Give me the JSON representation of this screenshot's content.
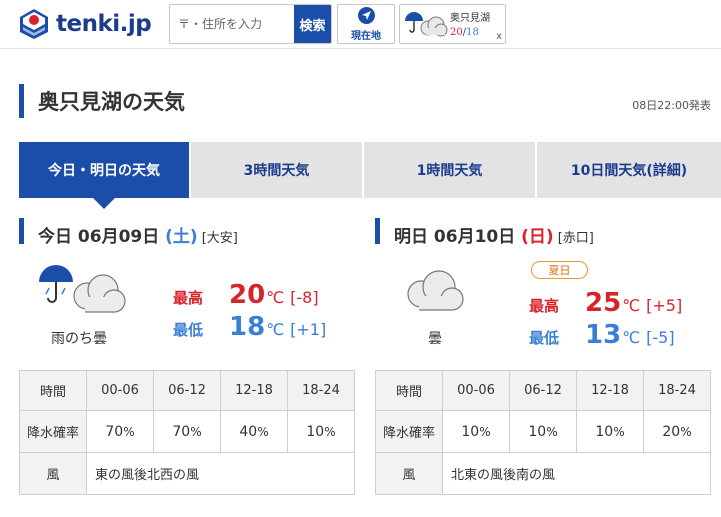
{
  "header": {
    "logo_text": "tenki.jp",
    "search_placeholder": "〒・住所を入力",
    "search_button": "検索",
    "location_button": "現在地",
    "mini_card": {
      "place": "奥只見湖",
      "high": "20",
      "separator": "/",
      "low": "18",
      "close": "x"
    }
  },
  "page": {
    "title": "奥只見湖の天気",
    "announced": "08日22:00発表"
  },
  "tabs": [
    {
      "label": "今日・明日の天気",
      "active": true
    },
    {
      "label": "3時間天気",
      "active": false
    },
    {
      "label": "1時間天気",
      "active": false
    },
    {
      "label": "10日間天気(詳細)",
      "active": false
    }
  ],
  "today": {
    "prefix": "今日 06月09日 ",
    "weekday": "(土)",
    "rokuyo": "[大安]",
    "telop": "雨のち曇",
    "high_label": "最高",
    "high": "20",
    "high_unit": "℃",
    "high_diff": "[-8]",
    "low_label": "最低",
    "low": "18",
    "low_unit": "℃",
    "low_diff": "[+1]",
    "table": {
      "time_label": "時間",
      "slots": [
        "00-06",
        "06-12",
        "12-18",
        "18-24"
      ],
      "precip_label": "降水確率",
      "precip": [
        "70",
        "70",
        "40",
        "10"
      ],
      "precip_unit": "%",
      "wind_label": "風",
      "wind": "東の風後北西の風"
    }
  },
  "tomorrow": {
    "prefix": "明日 06月10日 ",
    "weekday": "(日)",
    "rokuyo": "[赤口]",
    "badge": "夏日",
    "telop": "曇",
    "high_label": "最高",
    "high": "25",
    "high_unit": "℃",
    "high_diff": "[+5]",
    "low_label": "最低",
    "low": "13",
    "low_unit": "℃",
    "low_diff": "[-5]",
    "table": {
      "time_label": "時間",
      "slots": [
        "00-06",
        "06-12",
        "12-18",
        "18-24"
      ],
      "precip_label": "降水確率",
      "precip": [
        "10",
        "10",
        "10",
        "20"
      ],
      "precip_unit": "%",
      "wind_label": "風",
      "wind": "北東の風後南の風"
    }
  },
  "colors": {
    "brand": "#1b4ea8",
    "high": "#d8232a",
    "low": "#3a7fd5",
    "saturday": "#3a7fd5",
    "sunday": "#d8232a",
    "badge": "#e89b2a"
  }
}
